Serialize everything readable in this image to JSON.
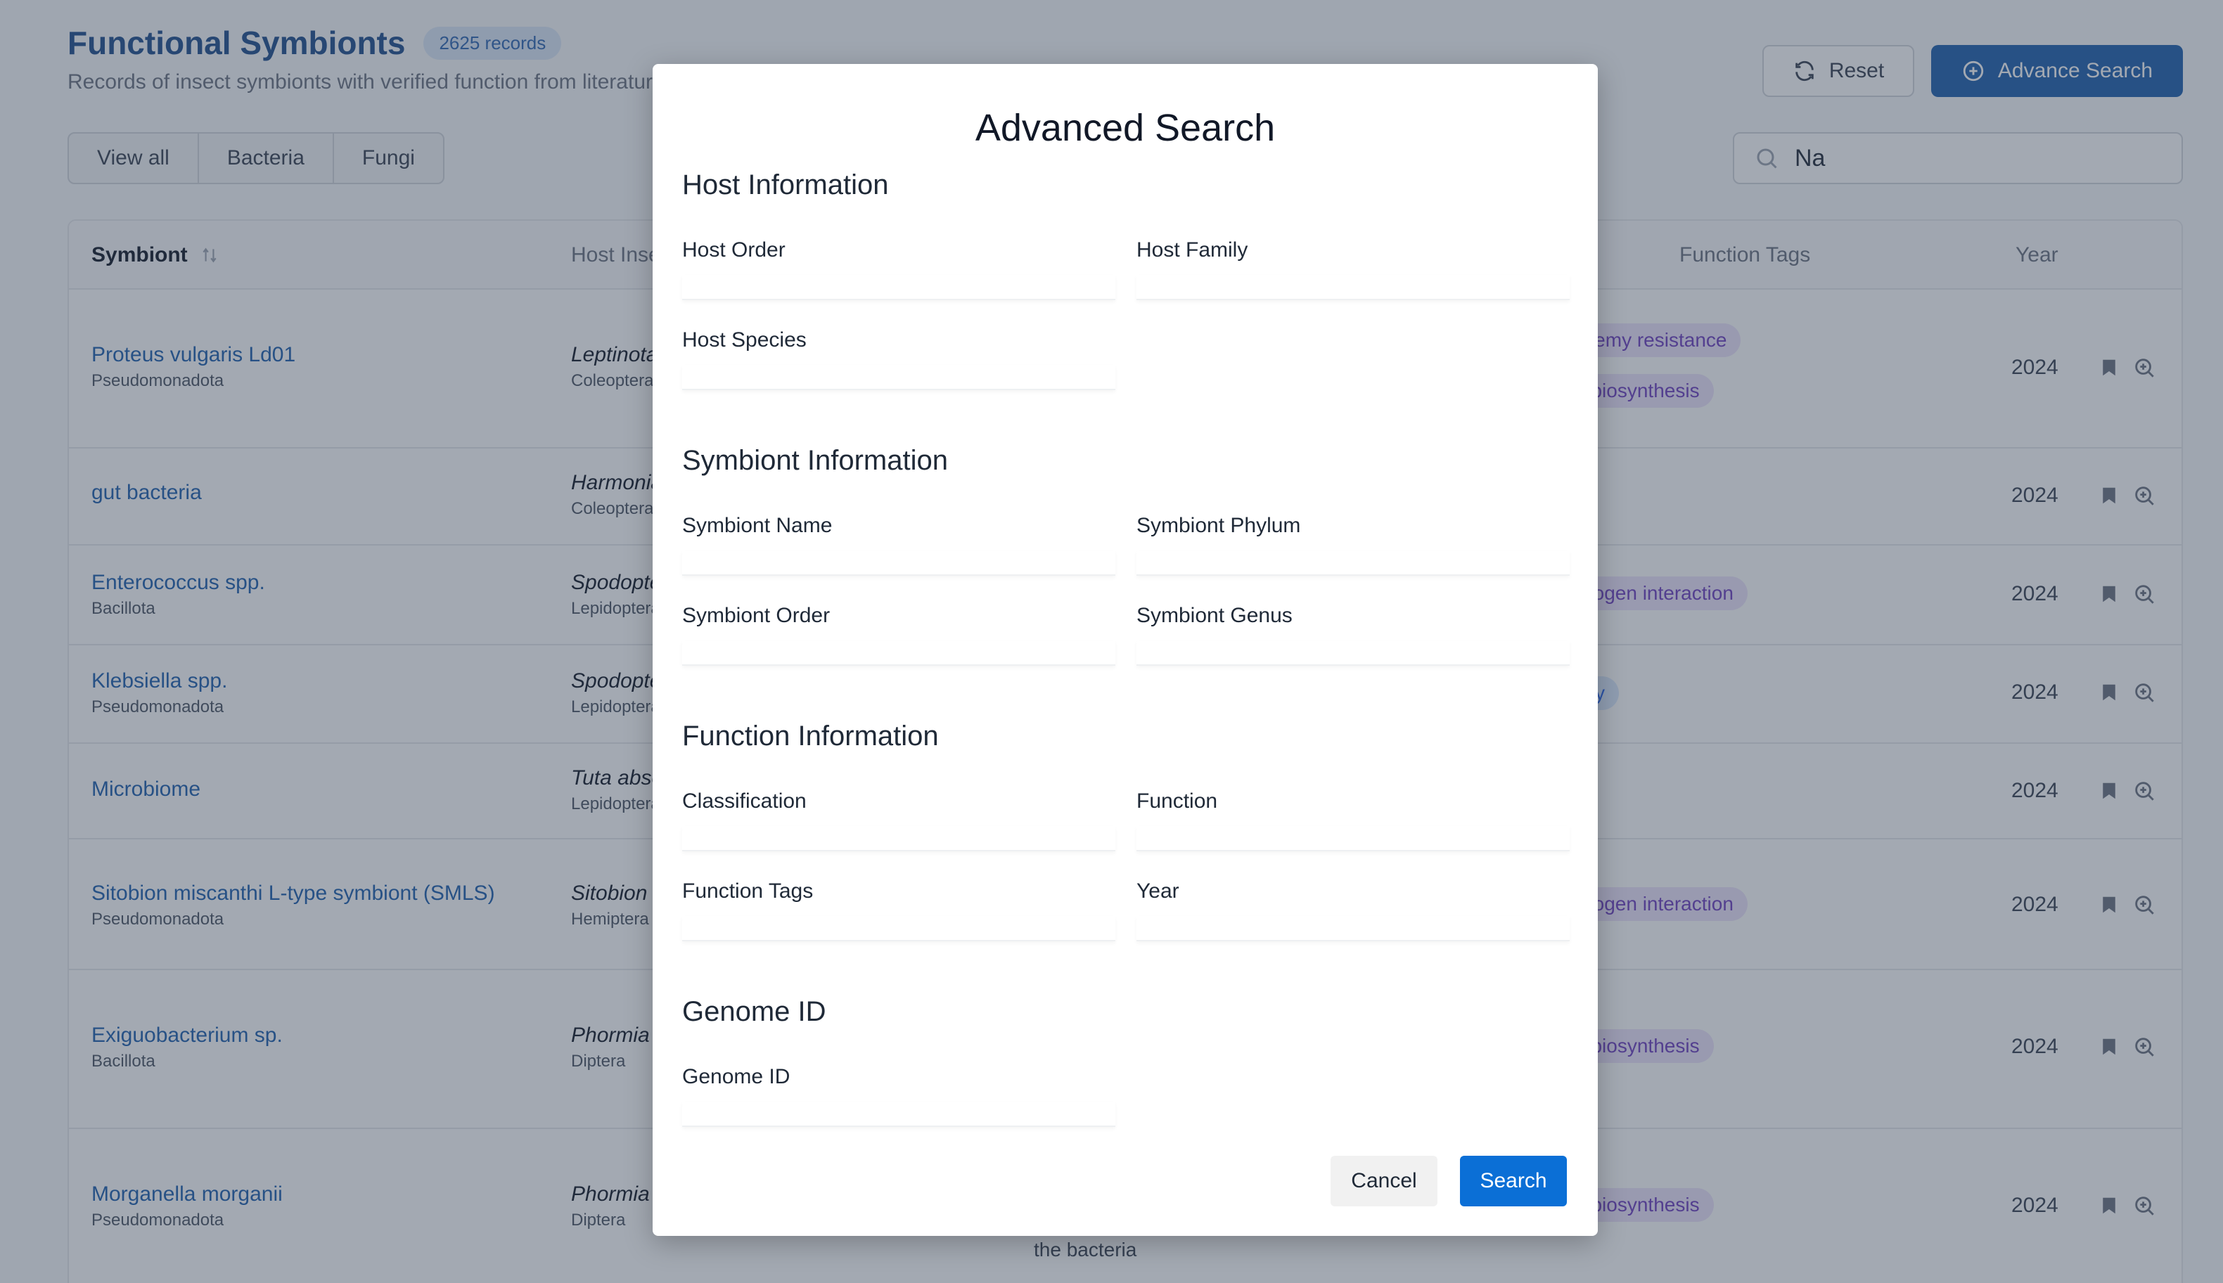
{
  "header": {
    "title": "Functional Symbionts",
    "records_badge": "2625 records",
    "subtitle": "Records of insect symbionts with verified function from literature",
    "reset_label": "Reset",
    "advance_search_label": "Advance Search"
  },
  "filters": {
    "segments": [
      "View all",
      "Bacteria",
      "Fungi"
    ],
    "search_value": "Na"
  },
  "table": {
    "columns": {
      "symbiont": "Symbiont",
      "host": "Host Insect",
      "function_tags": "Function Tags",
      "year": "Year"
    },
    "rows": [
      {
        "symbiont": "Proteus vulgaris Ld01",
        "phylum": "Pseudomonadota",
        "host": "Leptinotarsa",
        "host_order": "Coleoptera",
        "tags": [
          "Natural enemy resistance",
          "Chemical biosynthesis"
        ],
        "year": "2024"
      },
      {
        "symbiont": "gut bacteria",
        "phylum": "",
        "host": "Harmonia",
        "host_order": "Coleoptera",
        "tags": [],
        "year": "2024"
      },
      {
        "symbiont": "Enterococcus spp.",
        "phylum": "Bacillota",
        "host": "Spodoptera",
        "host_order": "Lepidoptera",
        "tags": [
          "Plant-pathogen interaction"
        ],
        "year": "2024"
      },
      {
        "symbiont": "Klebsiella spp.",
        "phylum": "Pseudomonadota",
        "host": "Spodoptera",
        "host_order": "Lepidoptera",
        "tags": [
          "y"
        ],
        "year": "2024"
      },
      {
        "symbiont": "Microbiome",
        "phylum": "",
        "host": "Tuta absoluta",
        "host_order": "Lepidoptera",
        "tags": [],
        "year": "2024"
      },
      {
        "symbiont": "Sitobion miscanthi L-type symbiont (SMLS)",
        "phylum": "Pseudomonadota",
        "host": "Sitobion",
        "host_order": "Hemiptera",
        "tags": [
          "Plant-pathogen interaction"
        ],
        "year": "2024"
      },
      {
        "symbiont": "Exiguobacterium sp.",
        "phylum": "Bacillota",
        "host": "Phormia",
        "host_order": "Diptera",
        "tags": [
          "Chemical biosynthesis"
        ],
        "year": "2024"
      },
      {
        "symbiont": "Morganella morganii",
        "phylum": "Pseudomonadota",
        "host": "Phormia",
        "host_order": "Diptera",
        "tags": [
          "Chemical biosynthesis"
        ],
        "year": "2024"
      }
    ],
    "extra_text": "the bacteria"
  },
  "modal": {
    "title": "Advanced Search",
    "sections": {
      "host": {
        "title": "Host Information",
        "host_order": "Host Order",
        "host_family": "Host Family",
        "host_species": "Host Species"
      },
      "symbiont": {
        "title": "Symbiont Information",
        "symbiont_name": "Symbiont Name",
        "symbiont_phylum": "Symbiont Phylum",
        "symbiont_order": "Symbiont Order",
        "symbiont_genus": "Symbiont Genus"
      },
      "function": {
        "title": "Function Information",
        "classification": "Classification",
        "function": "Function",
        "function_tags": "Function Tags",
        "year": "Year"
      },
      "genome": {
        "title": "Genome ID",
        "genome_id": "Genome ID"
      }
    },
    "cancel_label": "Cancel",
    "search_label": "Search"
  },
  "colors": {
    "primary": "#1e5fae",
    "search_button": "#0b6fd6",
    "tag_purple": "#ede4fb",
    "overlay": "rgba(51,65,85,0.45)"
  }
}
